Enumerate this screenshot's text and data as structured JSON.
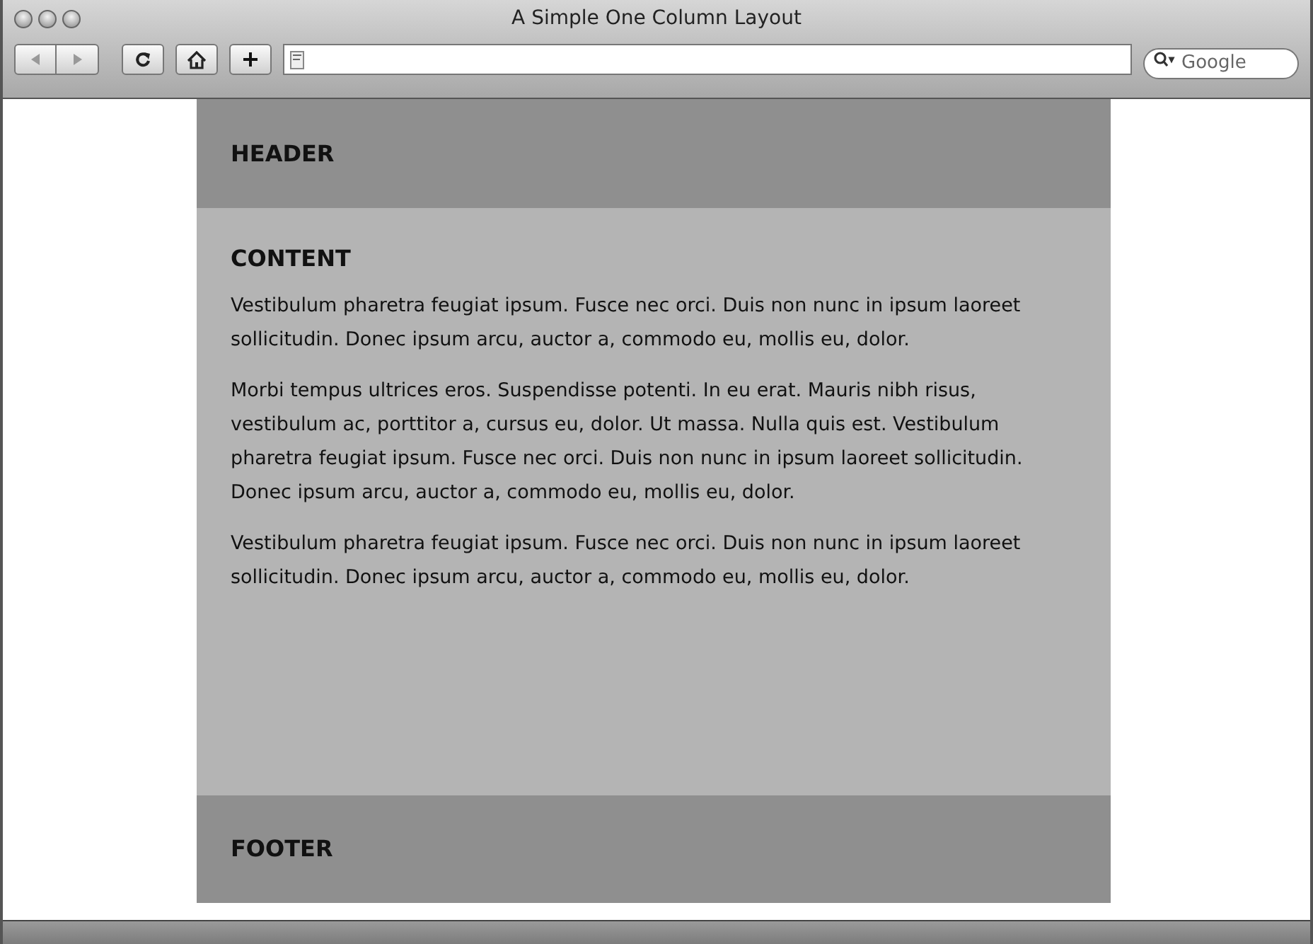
{
  "window": {
    "title": "A Simple One Column Layout"
  },
  "search": {
    "placeholder": "Google"
  },
  "page": {
    "header": "HEADER",
    "content": {
      "heading": "CONTENT",
      "paragraphs": [
        "Vestibulum pharetra feugiat ipsum. Fusce nec orci. Duis non nunc in ipsum laoreet sollicitudin. Donec ipsum arcu, auctor a, commodo eu, mollis eu, dolor.",
        "Morbi tempus ultrices eros. Suspendisse potenti. In eu erat. Mauris nibh risus, vestibulum ac, porttitor a, cursus eu, dolor. Ut massa. Nulla quis est. Vestibulum pharetra feugiat ipsum. Fusce nec orci. Duis non nunc in ipsum laoreet sollicitudin. Donec ipsum arcu, auctor a, commodo eu, mollis eu, dolor.",
        "Vestibulum pharetra feugiat ipsum. Fusce nec orci. Duis non nunc in ipsum laoreet sollicitudin. Donec ipsum arcu, auctor a, commodo eu, mollis eu, dolor."
      ]
    },
    "footer": "FOOTER"
  }
}
